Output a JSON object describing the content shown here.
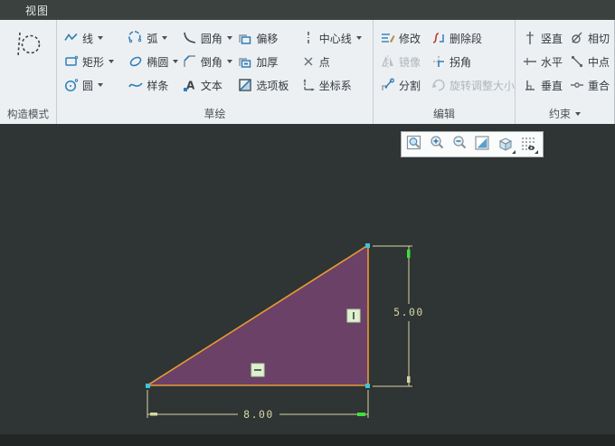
{
  "titlebar": {
    "tab": "视图"
  },
  "ribbon": {
    "construction_mode": "构造模式",
    "sketch": {
      "label": "草绘",
      "line": "线",
      "rectangle": "矩形",
      "circle": "圆",
      "arc": "弧",
      "ellipse": "椭圆",
      "spline": "样条",
      "fillet": "圆角",
      "chamfer": "倒角",
      "text": "文本",
      "offset": "偏移",
      "thicken": "加厚",
      "palette": "选项板",
      "centerline": "中心线",
      "point": "点",
      "csys": "坐标系"
    },
    "edit": {
      "label": "编辑",
      "modify": "修改",
      "delete_segment": "删除段",
      "mirror": "镜像",
      "corner": "拐角",
      "divide": "分割",
      "rotate_resize": "旋转调整大小"
    },
    "constrain": {
      "label": "约束",
      "vertical": "竖直",
      "tangent": "相切",
      "horizontal": "水平",
      "midpoint": "中点",
      "perpendicular": "垂直",
      "coincident": "重合"
    }
  },
  "viewer_toolbar": {
    "icons": [
      "zoom-window",
      "zoom-in",
      "zoom-out",
      "display-style",
      "saved-views",
      "datum-display"
    ]
  },
  "sketch_canvas": {
    "dimensions": {
      "width_value": "8.00",
      "height_value": "5.00"
    },
    "constraints_shown": [
      "vertical-edge-constraint",
      "horizontal-edge-constraint"
    ],
    "colors": {
      "canvas_bg": "#2f3434",
      "triangle_fill": "#6b4168",
      "triangle_edge": "#e79a33",
      "dimension": "#d6d6a2",
      "highlight_green": "#3fe03c",
      "vertex": "#3ec4d4",
      "constraint_marker_bg": "#dff0cf"
    }
  }
}
